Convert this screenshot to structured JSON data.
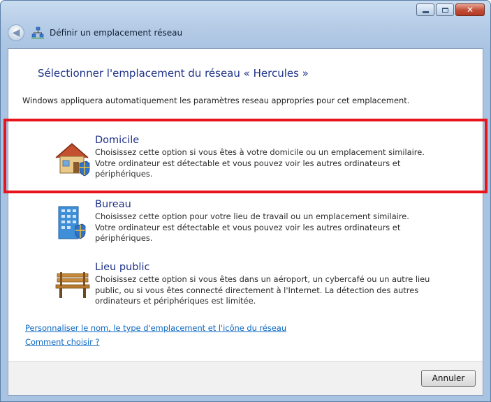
{
  "window": {
    "title": "Définir un emplacement réseau",
    "controls": {
      "minimize_icon": "minimize-icon",
      "maximize_icon": "maximize-icon",
      "close_icon": "close-icon"
    }
  },
  "main": {
    "heading_prefix": "Sélectionner l'emplacement du réseau ",
    "heading_network": "« Hercules »",
    "description": "Windows appliquera automatiquement les paramètres reseau appropries pour cet emplacement.",
    "options": [
      {
        "title": "Domicile",
        "icon": "house-icon",
        "description": "Choisissez cette option si vous êtes à votre domicile ou un emplacement similaire. Votre ordinateur est détectable et vous pouvez voir les autres ordinateurs et périphériques."
      },
      {
        "title": "Bureau",
        "icon": "office-building-icon",
        "description": "Choisissez cette option pour votre lieu de travail ou un emplacement similaire. Votre ordinateur est détectable et vous pouvez voir les autres ordinateurs et périphériques."
      },
      {
        "title": "Lieu public",
        "icon": "park-bench-icon",
        "description": "Choisissez cette option si vous êtes dans un aéroport, un cybercafé ou un autre lieu public, ou si vous êtes connecté directement à l'Internet. La détection des autres ordinateurs et périphériques est limitée."
      }
    ],
    "links": {
      "customize": "Personnaliser le nom, le type d'emplacement et l'icône du réseau",
      "help": "Comment choisir ?"
    }
  },
  "footer": {
    "cancel_label": "Annuler"
  },
  "colors": {
    "highlight": "#e8141b",
    "heading": "#1e3287",
    "link": "#0a66c2"
  }
}
